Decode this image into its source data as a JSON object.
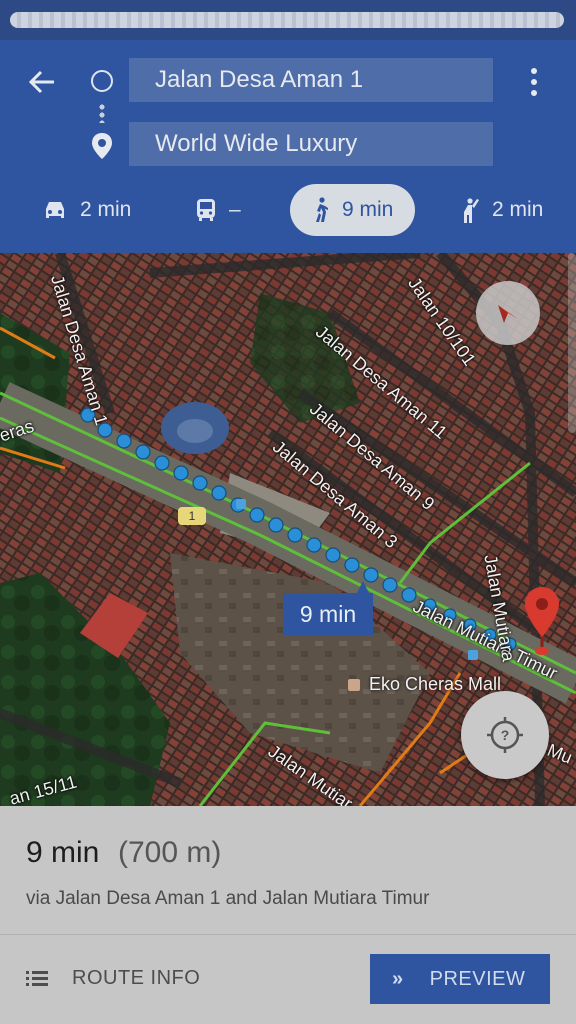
{
  "header": {
    "origin_value": "Jalan Desa Aman 1",
    "destination_value": "World Wide Luxury",
    "back_icon": "arrow-left-icon",
    "more_icon": "more-vert-icon"
  },
  "modes": [
    {
      "name": "drive",
      "icon": "car-icon",
      "label": "2 min"
    },
    {
      "name": "transit",
      "icon": "bus-icon",
      "label": "–"
    },
    {
      "name": "walk",
      "icon": "walk-icon",
      "label": "9 min",
      "active": true
    },
    {
      "name": "ride",
      "icon": "ride-hail-icon",
      "label": "2 min"
    }
  ],
  "map": {
    "streets": {
      "desa_aman_1": "Jalan Desa Aman 1",
      "desa_aman_11": "Jalan Desa Aman 11",
      "desa_aman_9": "Jalan Desa Aman 9",
      "desa_aman_3": "Jalan Desa Aman 3",
      "jalan_10_101": "Jalan 10/101",
      "mutiara_timur": "Jalan Mutiara Timur",
      "jalan_mutiara": "Jalan Mutiara",
      "jalan_mutiara_bottom": "Jalan Mutiar",
      "cheras": "eras",
      "jalan_15_11": "an 15/11",
      "mu": "Mu"
    },
    "route_badge": "9 min",
    "poi": "Eko Cheras Mall",
    "road_shield": "1",
    "colors": {
      "route": "#2a8fd6",
      "traffic_green": "#5fbf3b",
      "traffic_orange": "#e07b16",
      "marker": "#d93a2f"
    }
  },
  "sheet": {
    "time": "9 min",
    "distance": "(700 m)",
    "via": "via Jalan Desa Aman 1 and Jalan Mutiara Timur",
    "route_info_label": "ROUTE INFO",
    "preview_label": "PREVIEW"
  }
}
